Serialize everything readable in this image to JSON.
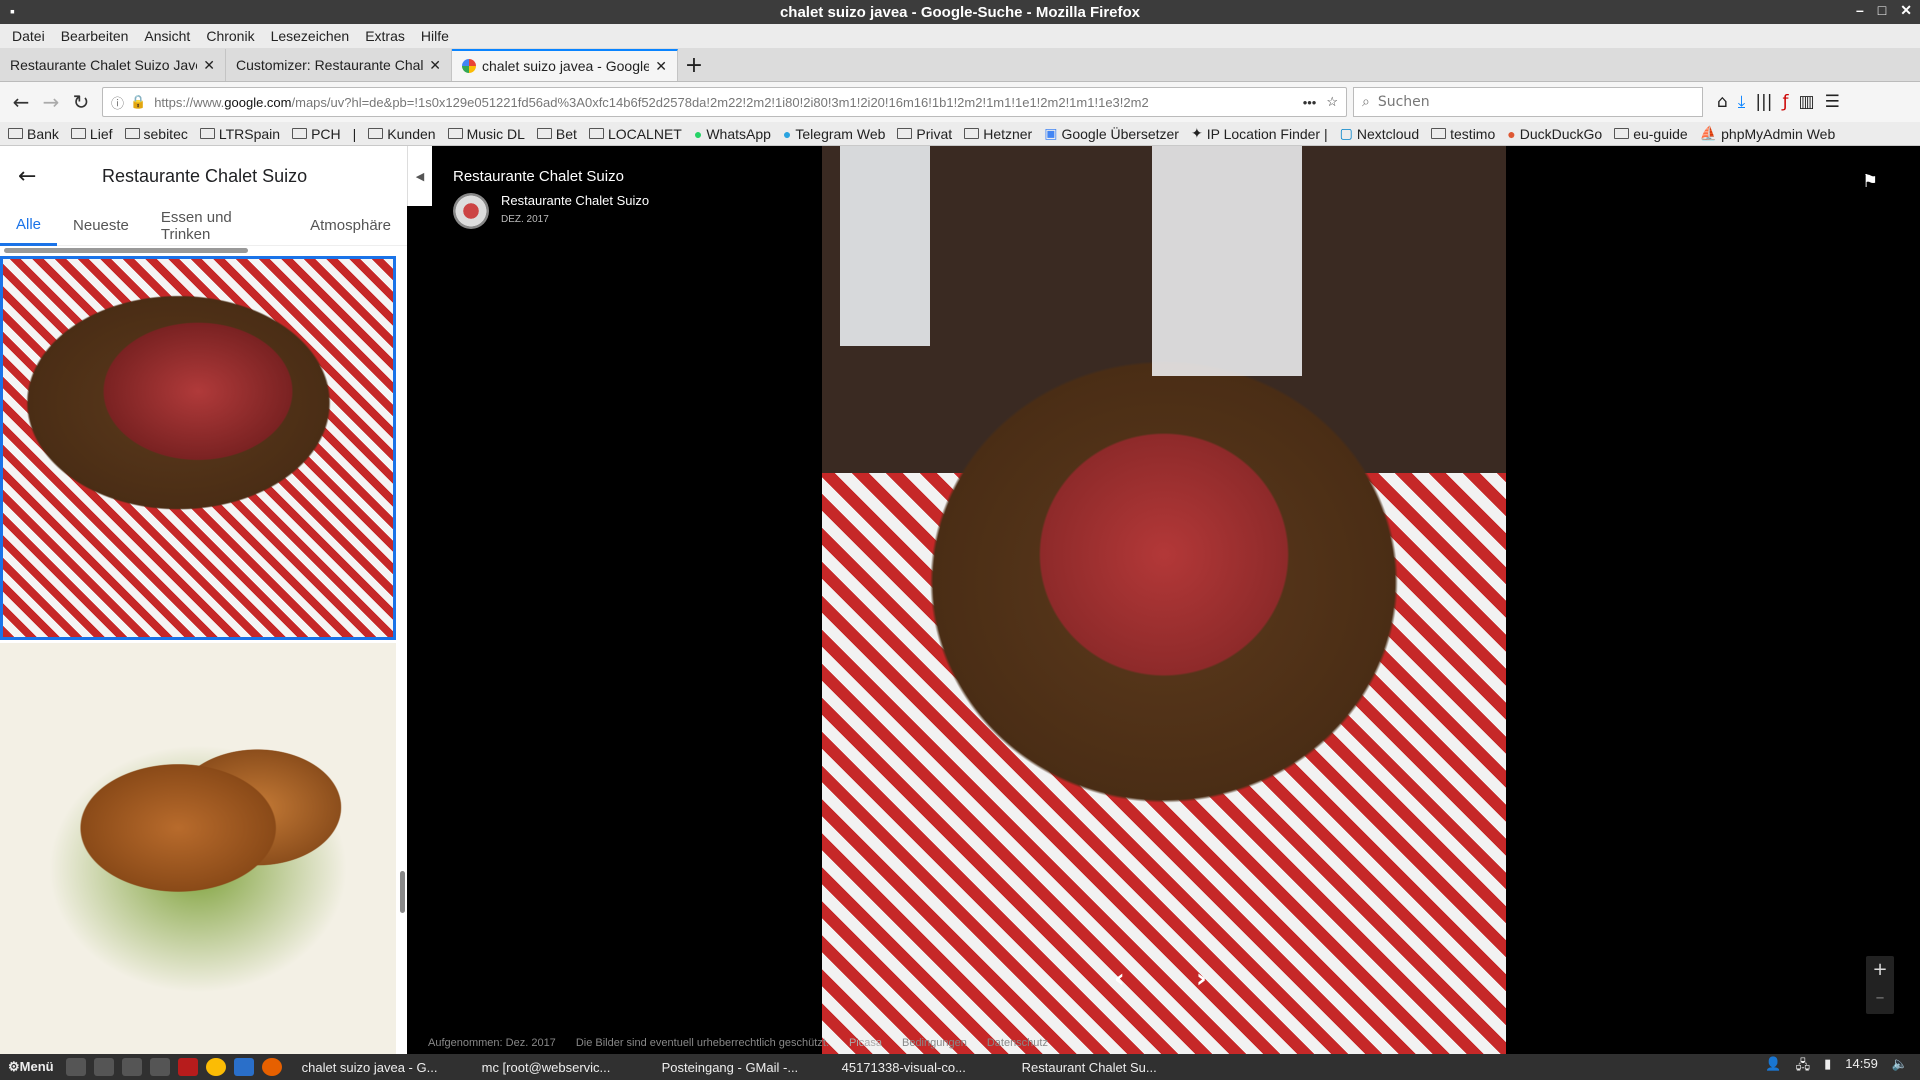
{
  "window": {
    "title": "chalet suizo javea - Google-Suche - Mozilla Firefox",
    "controls": [
      "–",
      "□",
      "✕"
    ]
  },
  "menubar": [
    "Datei",
    "Bearbeiten",
    "Ansicht",
    "Chronik",
    "Lesezeichen",
    "Extras",
    "Hilfe"
  ],
  "tabs": [
    {
      "label": "Restaurante Chalet Suizo Javea",
      "close": "✕"
    },
    {
      "label": "Customizer: Restaurante Chalet",
      "close": "✕"
    },
    {
      "label": "chalet suizo javea - Google",
      "close": "✕"
    }
  ],
  "newtab": "+",
  "nav": {
    "url_prefix": "https://www.",
    "url_domain": "google.com",
    "url_path": "/maps/uv?hl=de&pb=!1s0x129e051221fd56ad%3A0xfc14b6f52d2578da!2m22!2m2!1i80!2i80!3m1!2i20!16m16!1b1!2m2!1m1!1e1!2m2!1m1!1e3!2m2",
    "more": "•••",
    "search_placeholder": "Suchen"
  },
  "bookmarks": [
    "Bank",
    "Lief",
    "sebitec",
    "LTRSpain",
    "PCH",
    "|",
    "Kunden",
    "Music DL",
    "Bet",
    "LOCALNET",
    "WhatsApp",
    "Telegram Web",
    "Privat",
    "Hetzner",
    "Google Übersetzer",
    "IP Location Finder |",
    "Nextcloud",
    "testimo",
    "DuckDuckGo",
    "eu-guide",
    "phpMyAdmin Web"
  ],
  "sidebar": {
    "title": "Restaurante Chalet Suizo",
    "tabs": [
      "Alle",
      "Neueste",
      "Essen und Trinken",
      "Atmosphäre"
    ]
  },
  "viewer": {
    "place_title": "Restaurante Chalet Suizo",
    "author": "Restaurante Chalet Suizo",
    "date": "DEZ. 2017",
    "footer": [
      "Aufgenommen: Dez. 2017",
      "Die Bilder sind eventuell urheberrechtlich geschützt.",
      "Picasa",
      "Bedingungen",
      "Datenschutz"
    ],
    "zoom_in": "+",
    "zoom_out": "–"
  },
  "taskbar": {
    "menu": "Menü",
    "tasks": [
      "chalet suizo javea - G...",
      "mc [root@webservic...",
      "Posteingang - GMail -...",
      "45171338-visual-co...",
      "Restaurant Chalet Su..."
    ],
    "clock": "14:59"
  }
}
